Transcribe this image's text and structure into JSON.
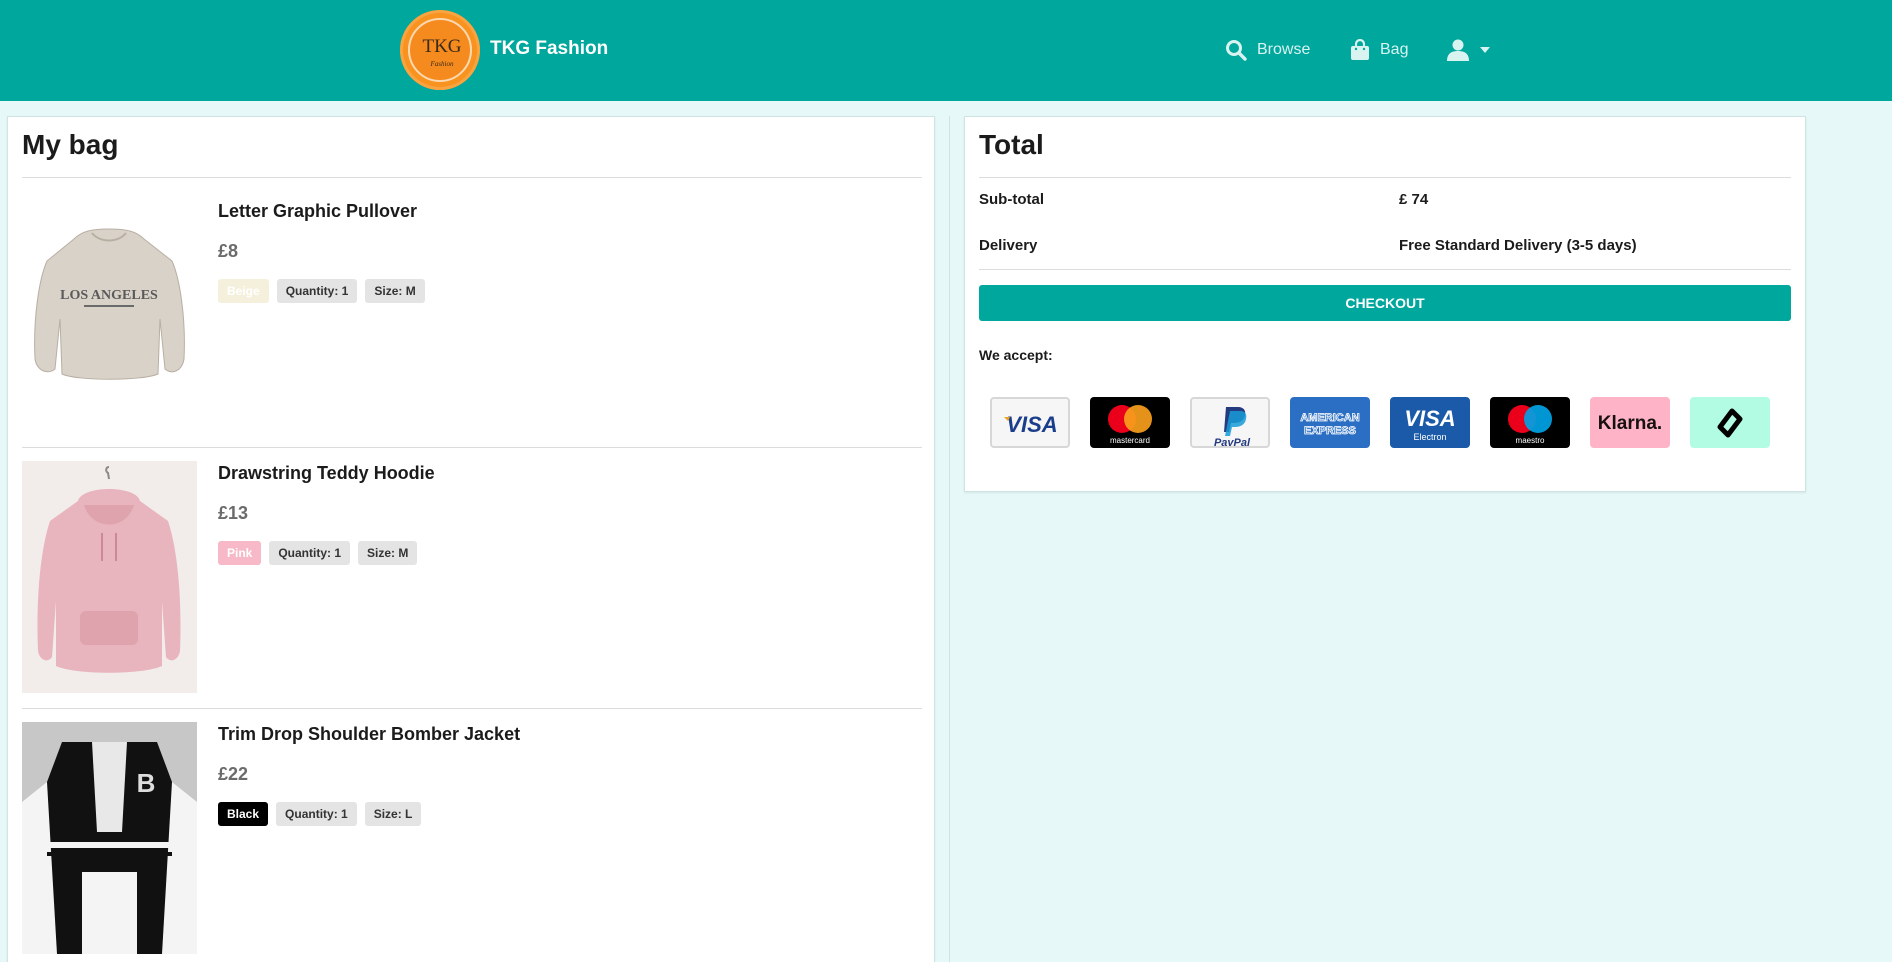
{
  "nav": {
    "logo_text": "TKG",
    "logo_script": "Fashion",
    "brand": "TKG Fashion",
    "browse_label": "Browse",
    "bag_label": "Bag"
  },
  "bag": {
    "title": "My bag",
    "items": [
      {
        "name": "Letter Graphic Pullover",
        "price": "£8",
        "color": "Beige",
        "quantity": "Quantity: 1",
        "size": "Size: M",
        "color_bg": "#f5f0dc",
        "color_fg": "#ffffff"
      },
      {
        "name": "Drawstring Teddy Hoodie",
        "price": "£13",
        "color": "Pink",
        "quantity": "Quantity: 1",
        "size": "Size: M",
        "color_bg": "#f7b8c8",
        "color_fg": "#ffffff"
      },
      {
        "name": "Trim Drop Shoulder Bomber Jacket",
        "price": "£22",
        "color": "Black",
        "quantity": "Quantity: 1",
        "size": "Size: L",
        "color_bg": "#000000",
        "color_fg": "#ffffff"
      }
    ]
  },
  "total": {
    "title": "Total",
    "subtotal_label": "Sub-total",
    "subtotal_value": "£ 74",
    "delivery_label": "Delivery",
    "delivery_value": "Free Standard Delivery (3-5 days)",
    "checkout_label": "CHECKOUT",
    "accept_label": "We accept:",
    "cards": {
      "visa": "VISA",
      "mastercard": "mastercard",
      "paypal": "PayPal",
      "amex_line1": "AMERICAN",
      "amex_line2": "EXPRESS",
      "visa_electron": "VISA",
      "visa_electron_sub": "Electron",
      "maestro": "maestro",
      "klarna": "Klarna."
    }
  },
  "colors": {
    "accent": "#00a79d",
    "page_bg": "#e6f9f8"
  }
}
